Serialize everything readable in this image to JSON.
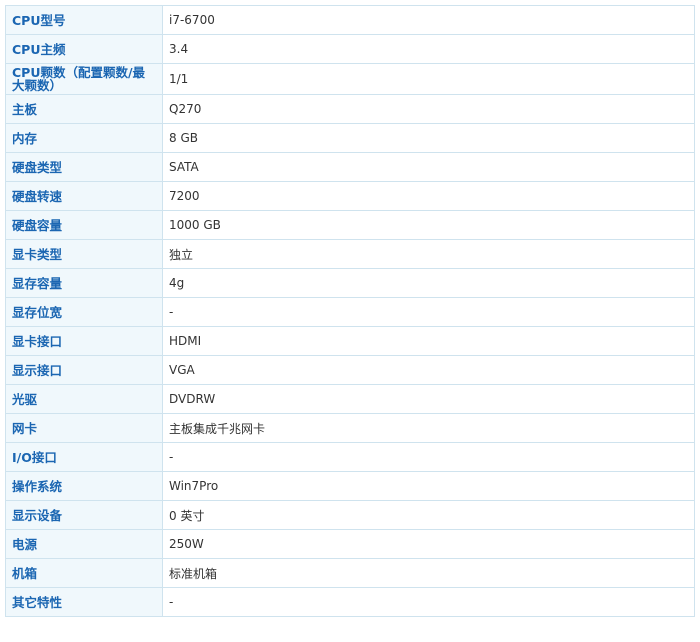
{
  "specs": [
    {
      "label": "CPU型号",
      "value": "i7-6700"
    },
    {
      "label": "CPU主频",
      "value": "3.4"
    },
    {
      "label": "CPU颗数（配置颗数/最大颗数）",
      "value": "1/1"
    },
    {
      "label": "主板",
      "value": "Q270"
    },
    {
      "label": "内存",
      "value": "8  GB"
    },
    {
      "label": "硬盘类型",
      "value": "SATA"
    },
    {
      "label": "硬盘转速",
      "value": "7200"
    },
    {
      "label": "硬盘容量",
      "value": "1000  GB"
    },
    {
      "label": "显卡类型",
      "value": "独立"
    },
    {
      "label": "显存容量",
      "value": "4g"
    },
    {
      "label": "显存位宽",
      "value": "-"
    },
    {
      "label": "显卡接口",
      "value": "HDMI"
    },
    {
      "label": "显示接口",
      "value": "VGA"
    },
    {
      "label": "光驱",
      "value": "DVDRW"
    },
    {
      "label": "网卡",
      "value": "主板集成千兆网卡"
    },
    {
      "label": "I/O接口",
      "value": "-"
    },
    {
      "label": "操作系统",
      "value": "Win7Pro"
    },
    {
      "label": "显示设备",
      "value": "0  英寸"
    },
    {
      "label": "电源",
      "value": "250W"
    },
    {
      "label": "机箱",
      "value": "标准机箱"
    },
    {
      "label": "其它特性",
      "value": "-"
    }
  ],
  "colors": {
    "label_text": "#1b66b2",
    "label_bg": "#f0f8fc",
    "border": "#cfe3ee",
    "value_text": "#333333"
  }
}
